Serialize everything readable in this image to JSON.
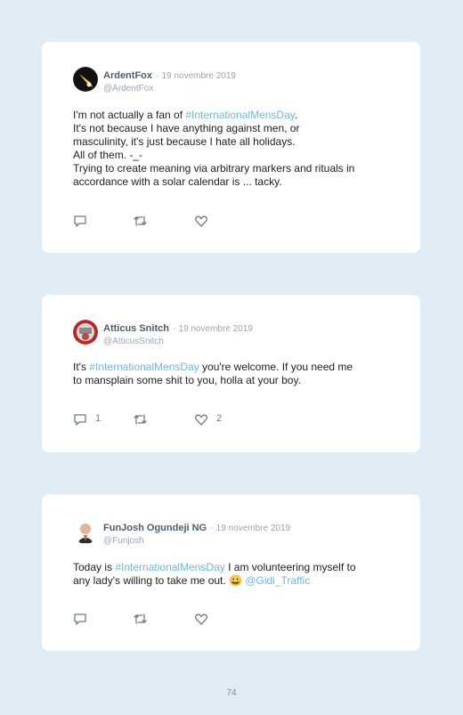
{
  "tweets": [
    {
      "name": "ArdentFox",
      "date": "· 19 novembre 2019",
      "handle": "@ArdentFox",
      "lines": [
        {
          "before": "I'm not actually a fan of ",
          "tag": "#InternationalMensDay",
          "after": "."
        },
        {
          "before": "It's not because I have anything against men, or",
          "tag": "",
          "after": ""
        },
        {
          "before": "masculinity, it's just because I hate all holidays.",
          "tag": "",
          "after": ""
        },
        {
          "before": "All of them. -_-",
          "tag": "",
          "after": ""
        },
        {
          "before": "Trying to create meaning via arbitrary markers and rituals in",
          "tag": "",
          "after": ""
        },
        {
          "before": "accordance with a solar calendar is ... tacky.",
          "tag": "",
          "after": ""
        }
      ],
      "replies": "",
      "likes": ""
    },
    {
      "name": "Atticus Snitch",
      "date": "· 19 novembre 2019",
      "handle": "@AtticusSnitch",
      "lines": [
        {
          "before": "It's ",
          "tag": "#InternationalMensDay",
          "after": " you're welcome. If you need me"
        },
        {
          "before": "to mansplain some shit to you, holla at your boy.",
          "tag": "",
          "after": ""
        }
      ],
      "replies": "1",
      "likes": "2"
    },
    {
      "name": "FunJosh Ogundeji NG",
      "date": "· 19 novembre 2019",
      "handle": "@Funjosh",
      "lines": [
        {
          "before": "Today is ",
          "tag": "#InternationalMensDay",
          "after": " I am volunteering myself to"
        },
        {
          "before": "any lady's willing to take me out. 😀 ",
          "tag": "@Gidi_Traffic",
          "after": ""
        }
      ],
      "replies": "",
      "likes": ""
    }
  ],
  "page_number": "74",
  "colors": {
    "background": "#e1edf6",
    "card": "#ffffff",
    "hashtag": "#6cb8e6",
    "name": "#4d5d6e",
    "muted": "#9aa7b3"
  },
  "icons": [
    "reply-icon",
    "retweet-icon",
    "like-icon"
  ]
}
